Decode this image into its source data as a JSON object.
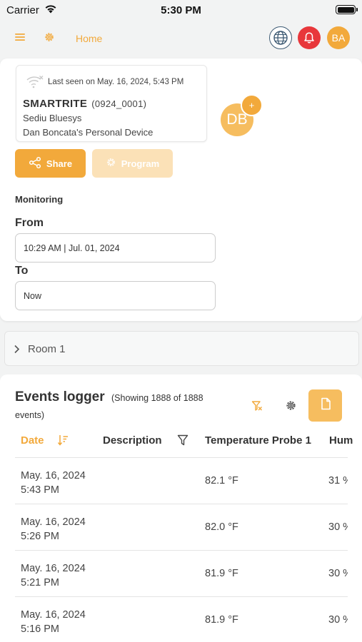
{
  "status_bar": {
    "carrier": "Carrier",
    "time": "5:30 PM"
  },
  "nav": {
    "home_label": "Home",
    "avatar_initials": "BA"
  },
  "device": {
    "last_seen": "Last seen on May. 16, 2024,    5:43 PM",
    "name": "SMARTRITE",
    "code": "(0924_0001)",
    "line1": "Sediu Bluesys",
    "line2": "Dan Boncata's Personal Device",
    "owner_initials": "DB",
    "add_symbol": "+"
  },
  "actions": {
    "share_label": "Share",
    "program_label": "Program"
  },
  "monitoring": {
    "title": "Monitoring",
    "from_label": "From",
    "from_value": "10:29 AM | Jul. 01, 2024",
    "to_label": "To",
    "to_value": "Now"
  },
  "room": {
    "label": "Room 1"
  },
  "events": {
    "title": "Events logger",
    "showing_1": "(Showing 1888 of 1888",
    "showing_2": "events)",
    "columns": {
      "date": "Date",
      "description": "Description",
      "temperature": "Temperature Probe 1",
      "humidity": "Hum"
    },
    "rows": [
      {
        "date": "May. 16, 2024",
        "time": "5:43 PM",
        "description": "",
        "temperature": "82.1 °F",
        "humidity": "31 %"
      },
      {
        "date": "May. 16, 2024",
        "time": "5:26 PM",
        "description": "",
        "temperature": "82.0 °F",
        "humidity": "30 %"
      },
      {
        "date": "May. 16, 2024",
        "time": "5:21 PM",
        "description": "",
        "temperature": "81.9 °F",
        "humidity": "30 %"
      },
      {
        "date": "May. 16, 2024",
        "time": "5:16 PM",
        "description": "",
        "temperature": "81.9 °F",
        "humidity": "30 %"
      }
    ]
  },
  "colors": {
    "accent": "#f2a93b",
    "accent_light": "#fbe1b7",
    "alert": "#e8373b",
    "globe": "#3d5a73"
  },
  "icons": [
    "wifi-icon",
    "battery-icon",
    "menu-icon",
    "gear-icon",
    "globe-icon",
    "bell-icon",
    "wifi-off-icon",
    "share-icon",
    "chevron-right-icon",
    "filter-clear-icon",
    "sort-icon",
    "filter-icon",
    "document-icon"
  ]
}
